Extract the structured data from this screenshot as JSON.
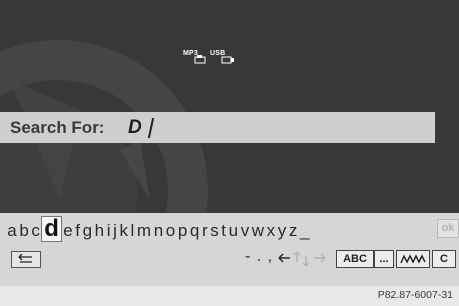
{
  "media_icons": [
    {
      "label": "MP3",
      "name": "mp3-media-icon"
    },
    {
      "label": "USB",
      "name": "usb-media-icon"
    }
  ],
  "search": {
    "label": "Search For:",
    "value": "D"
  },
  "keyboard": {
    "letters": [
      "a",
      "b",
      "c",
      "d",
      "e",
      "f",
      "g",
      "h",
      "i",
      "j",
      "k",
      "l",
      "m",
      "n",
      "o",
      "p",
      "q",
      "r",
      "s",
      "t",
      "u",
      "v",
      "w",
      "x",
      "y",
      "z",
      "_"
    ],
    "selected_letter": "d",
    "ok_label": "ok",
    "punctuation": "- . ,",
    "abc_label": "ABC",
    "dots_label": "...",
    "clear_label": "C"
  },
  "footer": {
    "code": "P82.87-6007-31"
  },
  "colors": {
    "screen_bg": "#383838",
    "search_bar": "#cfcfcf",
    "keyboard_bg": "#d6d6d6"
  }
}
